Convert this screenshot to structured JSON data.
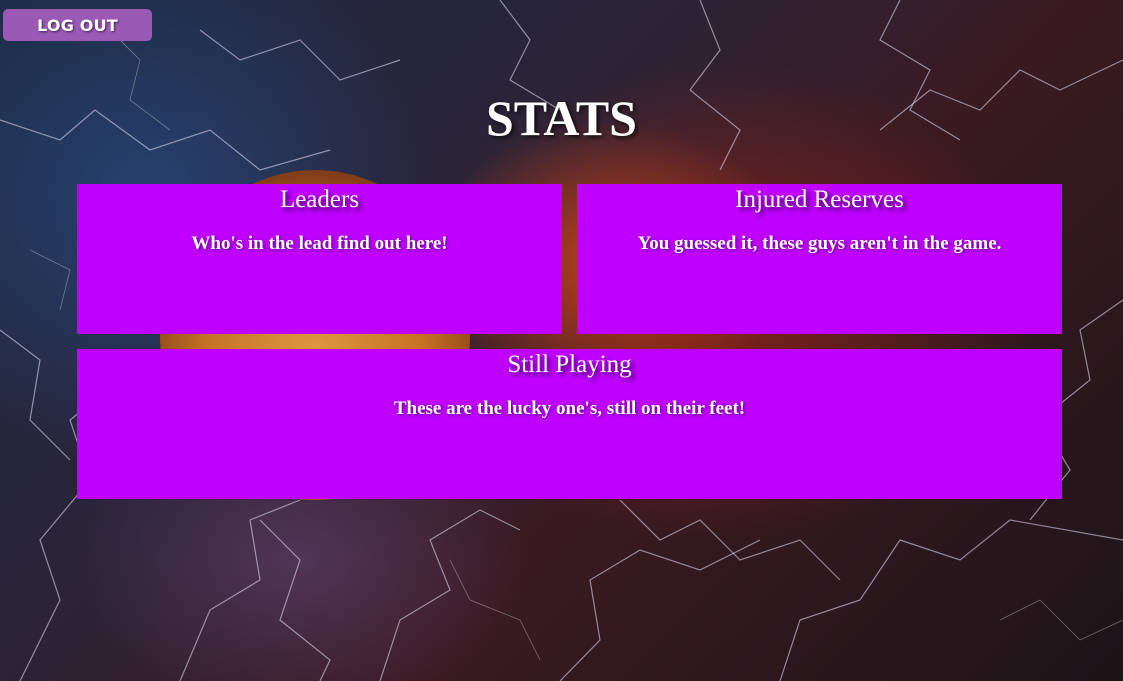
{
  "header": {
    "logout_label": "LOG OUT"
  },
  "page": {
    "title": "STATS"
  },
  "cards": [
    {
      "title": "Leaders",
      "description": "Who's in the lead find out here!"
    },
    {
      "title": "Injured Reserves",
      "description": "You guessed it, these guys aren't in the game."
    },
    {
      "title": "Still Playing",
      "description": "These are the lucky one's, still on their feet!"
    }
  ],
  "colors": {
    "card_background": "#bf00ff",
    "button_background": "#9b59b6",
    "text": "#ffffff"
  }
}
